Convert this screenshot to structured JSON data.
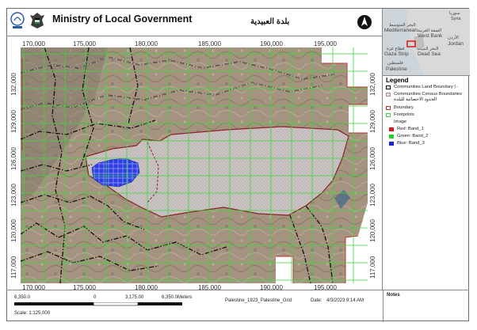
{
  "header": {
    "ministry": "Ministry of Local Government",
    "arabic_title": "بلدة العبيدية"
  },
  "inset_labels": [
    {
      "text": "سوريا"
    },
    {
      "text": "Syria"
    },
    {
      "text": "البحر المتوسط"
    },
    {
      "text": "Mediterranean"
    },
    {
      "text": "الضفة الغربية"
    },
    {
      "text": "West Bank"
    },
    {
      "text": "الأردن"
    },
    {
      "text": "Jordan"
    },
    {
      "text": "قطاع غزة"
    },
    {
      "text": "Gaza Strip"
    },
    {
      "text": "البحر الميت"
    },
    {
      "text": "Dead Sea"
    },
    {
      "text": "فلسطين"
    },
    {
      "text": "Palestine"
    }
  ],
  "map": {
    "x_ticks": [
      "170,000",
      "175,000",
      "180,000",
      "185,000",
      "190,000",
      "195,000"
    ],
    "y_ticks": [
      "132,000",
      "129,000",
      "126,000",
      "123,000",
      "120,000",
      "117,000"
    ]
  },
  "legend": {
    "title": "Legend",
    "items": [
      {
        "label": "Communities Land Boundary | -",
        "swatch": "outline-black"
      },
      {
        "label": "Communities Census Boundaries",
        "swatch": "none"
      },
      {
        "label": "الحدود الاحصائية للبلدة",
        "swatch": "none"
      },
      {
        "label": "Boundary",
        "swatch": "outline-red"
      },
      {
        "label": "Footprints",
        "swatch": "outline-green"
      },
      {
        "label": "Image",
        "swatch": "none"
      },
      {
        "label": "Red: Band_1",
        "swatch": "fill-red"
      },
      {
        "label": "Green: Band_2",
        "swatch": "fill-green"
      },
      {
        "label": "Blue: Band_3",
        "swatch": "fill-blue"
      }
    ]
  },
  "footer": {
    "scale_left": "6,350.0",
    "scale_zero": "0",
    "scale_mid": "3,175.00",
    "scale_right": "6,350.0Meters",
    "scale_text": "Scale:   1:125,000",
    "grid_name": "Palestine_1923_Palestine_Grid",
    "date_label": "Date:",
    "date_value": "4/3/2023 9:14 AM",
    "notes_label": "Notes"
  },
  "colors": {
    "community_fill": "#c8c0c0",
    "boundary_red": "#c0282d",
    "footprint_green": "#38d938",
    "built_up_blue": "#2231d6"
  }
}
